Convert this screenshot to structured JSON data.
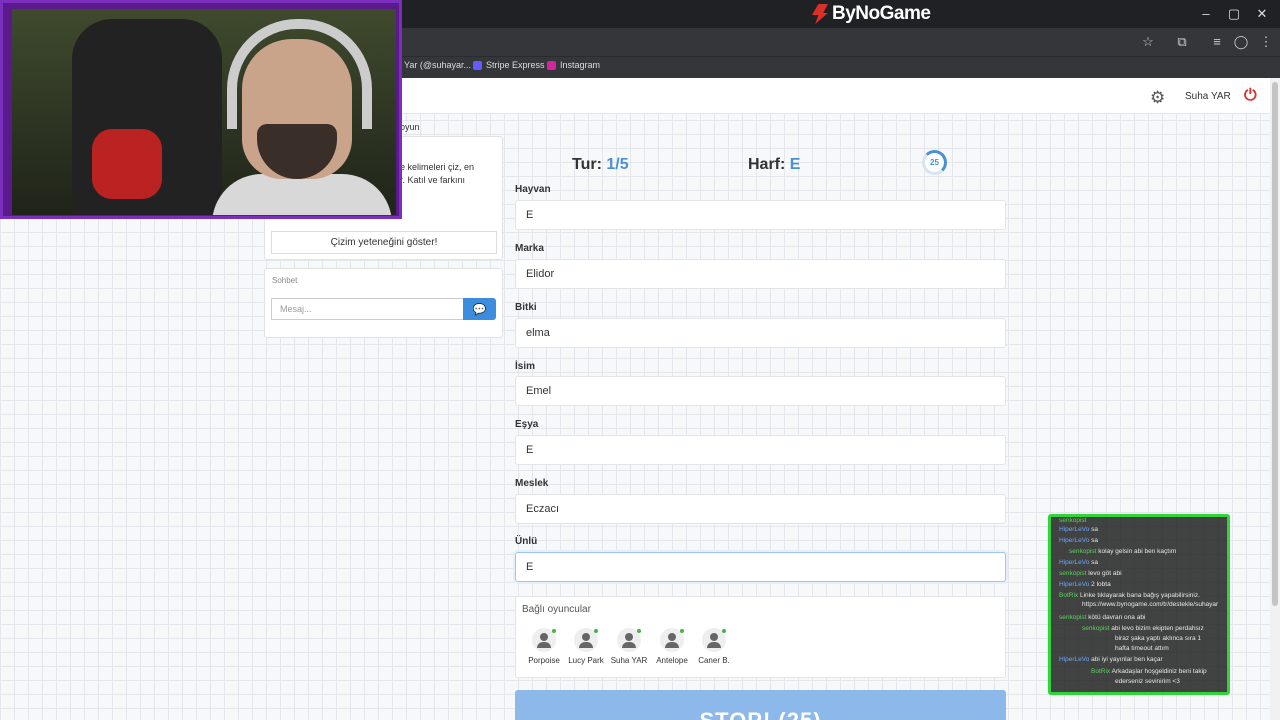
{
  "browser": {
    "brand": "ByNoGame",
    "bookmarks": [
      "Yar (@suhayar...",
      "Stripe Express",
      "Instagram"
    ],
    "window_controls": [
      "minimize-icon",
      "maximize-icon",
      "close-icon"
    ]
  },
  "topnav": {
    "username": "Suha YAR"
  },
  "left_panel": {
    "info_line1": "oyun",
    "info_line2": "e kelimeleri çiz, en",
    "info_line3": "r. Katıl ve farkını",
    "draw_button": "Çizim yeteneğini göster!",
    "chat_title": "Sohbet",
    "message_placeholder": "Mesaj..."
  },
  "game": {
    "round_label": "Tur:",
    "round_value": "1/5",
    "letter_label": "Harf:",
    "letter_value": "E",
    "timer": "25"
  },
  "fields": [
    {
      "label": "Hayvan",
      "value": "E"
    },
    {
      "label": "Marka",
      "value": "Elidor"
    },
    {
      "label": "Bitki",
      "value": "elma"
    },
    {
      "label": "İsim",
      "value": "Emel"
    },
    {
      "label": "Eşya",
      "value": "E"
    },
    {
      "label": "Meslek",
      "value": "Eczacı"
    },
    {
      "label": "Ünlü",
      "value": "E"
    }
  ],
  "players": {
    "title": "Bağlı oyuncular",
    "list": [
      "Porpoise",
      "Lucy Park",
      "Suha YAR",
      "Antelope",
      "Caner B."
    ]
  },
  "stop_button": "STOP! (25)",
  "stream_chat": [
    {
      "user": "senkopist",
      "color": "#5bd35b",
      "text": ""
    },
    {
      "user": "HiperLeVo",
      "color": "#6aa8ff",
      "text": "sa"
    },
    {
      "user": "HiperLeVo",
      "color": "#6aa8ff",
      "text": "sa"
    },
    {
      "user": "senkopist",
      "color": "#5bd35b",
      "text": "kolay gelsin abi ben kaçtım"
    },
    {
      "user": "HiperLeVo",
      "color": "#6aa8ff",
      "text": "sa"
    },
    {
      "user": "senkopist",
      "color": "#5bd35b",
      "text": "levo göt abi"
    },
    {
      "user": "HiperLeVo",
      "color": "#6aa8ff",
      "text": "2 lobta"
    },
    {
      "user": "BotRix",
      "color": "#5bd35b",
      "text": "Linke tıklayarak bana bağış yapabilirsiniz."
    },
    {
      "user": "",
      "color": "#e8e8e8",
      "text": "https://www.bynogame.com/tr/destekle/suhayar"
    },
    {
      "user": "senkopist",
      "color": "#5bd35b",
      "text": "kötü davran ona abi"
    },
    {
      "user": "senkopist",
      "color": "#5bd35b",
      "text": "abi levo bizim ekipten perdahsız"
    },
    {
      "user": "",
      "color": "#e8e8e8",
      "text": "biraz şaka yaptı aklınca sıra 1"
    },
    {
      "user": "",
      "color": "#e8e8e8",
      "text": "hafta timeout attım"
    },
    {
      "user": "HiperLeVo",
      "color": "#6aa8ff",
      "text": "abi iyi yayınlar ben kaçar"
    },
    {
      "user": "BotRix",
      "color": "#5bd35b",
      "text": "Arkadaşlar hoşgeldiniz beni takip"
    },
    {
      "user": "",
      "color": "#e8e8e8",
      "text": "ederseniz sevinirim <3"
    }
  ]
}
